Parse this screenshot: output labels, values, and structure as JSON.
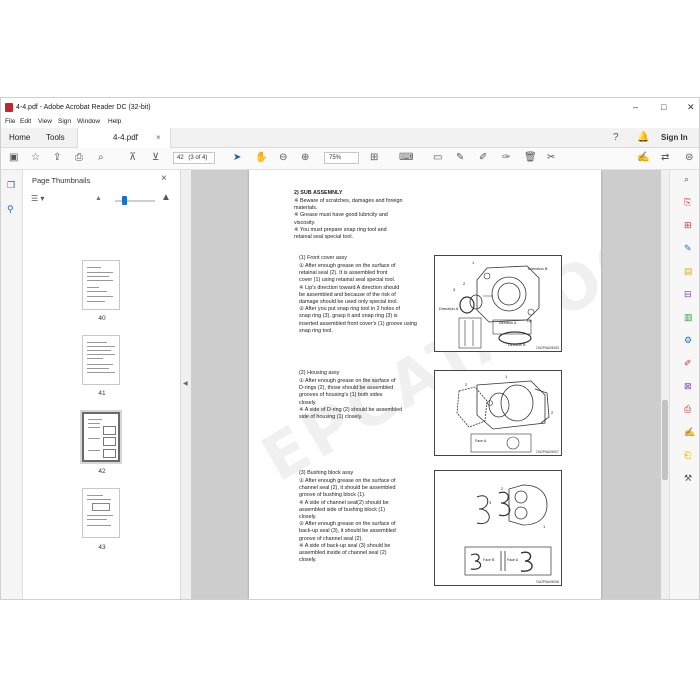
{
  "window": {
    "title": "4-4.pdf - Adobe Acrobat Reader DC (32-bit)",
    "controls": [
      "–",
      "□",
      "✕"
    ]
  },
  "menu": [
    "File",
    "Edit",
    "View",
    "Sign",
    "Window",
    "Help"
  ],
  "tabs": {
    "home": "Home",
    "tools": "Tools",
    "document": "4-4.pdf",
    "close": "×",
    "sign_in": "Sign In"
  },
  "toolbar": {
    "page_current": "42",
    "page_count": "(3 of 4)",
    "zoom": "75%"
  },
  "panel": {
    "title": "Page Thumbnails",
    "close": "×",
    "thumbnails": [
      {
        "label": "40",
        "selected": false
      },
      {
        "label": "41",
        "selected": false
      },
      {
        "label": "42",
        "selected": true
      },
      {
        "label": "43",
        "selected": false
      }
    ]
  },
  "page": {
    "watermark": "EPCATALOGS.COM",
    "section_title": "2) SUB ASSEMNLY",
    "general_notes": [
      "※ Beware of scratches, damages and foreign",
      "   materials.",
      "※ Grease must have good lubricity and",
      "   viscosity.",
      "※ You must prepare snap ring tool and",
      "   retainal seal special tool."
    ],
    "front_cover": {
      "heading": "(1) Front cover assy",
      "lines": [
        "① After enough grease on the surface of",
        "   retainal seal (2). It is assembled front",
        "   cover (1) using retainal seal special tool.",
        "※ Lip's direction toward A direction should",
        "   be assembled and because of the risk of",
        "   damage should be used only special tool.",
        "② After you put snap ring tool in 2 holes of",
        "   snap ring (3), grasp it and snap ring (3) is",
        "   inserted assembled front cover's (1) groove using",
        "   snap ring tool."
      ],
      "fig_labels": [
        "1",
        "2",
        "3",
        "Direction B",
        "Direction A",
        "Direction A",
        "Lip",
        "Direction B"
      ],
      "fig_code": "7AOP5A05053"
    },
    "housing": {
      "heading": "(2) Housing assy",
      "lines": [
        "① After enough grease on the surface of",
        "   D-rings (2), those should be assembled",
        "   grooves of housing's (1) both sides",
        "   closely.",
        "※ A side of D-ring (2) should be assembled",
        "   side of housing (1) closely."
      ],
      "fig_labels": [
        "1",
        "2",
        "2",
        "Face A"
      ],
      "fig_code": "7AOP5A05007"
    },
    "bushing": {
      "heading": "(3) Bushing block assy",
      "lines": [
        "① After enough grease on the surface of",
        "   channel seal (2), it should be assembled",
        "   groove of bushing block (1).",
        "※ A side of channel seal(2) should be",
        "   assembled side of bushing block (1)",
        "   closely.",
        "② After enough grease on the surface of",
        "   back-up seal (3), it should be assembled",
        "   groove of channel seal (2).",
        "※ A side of back-up seal (3) should be",
        "   assembled inside of channel seal (2)",
        "   closely."
      ],
      "fig_labels": [
        "3",
        "2",
        "1",
        "Face B",
        "Face A"
      ],
      "fig_code": "7AOP5A05008"
    }
  }
}
